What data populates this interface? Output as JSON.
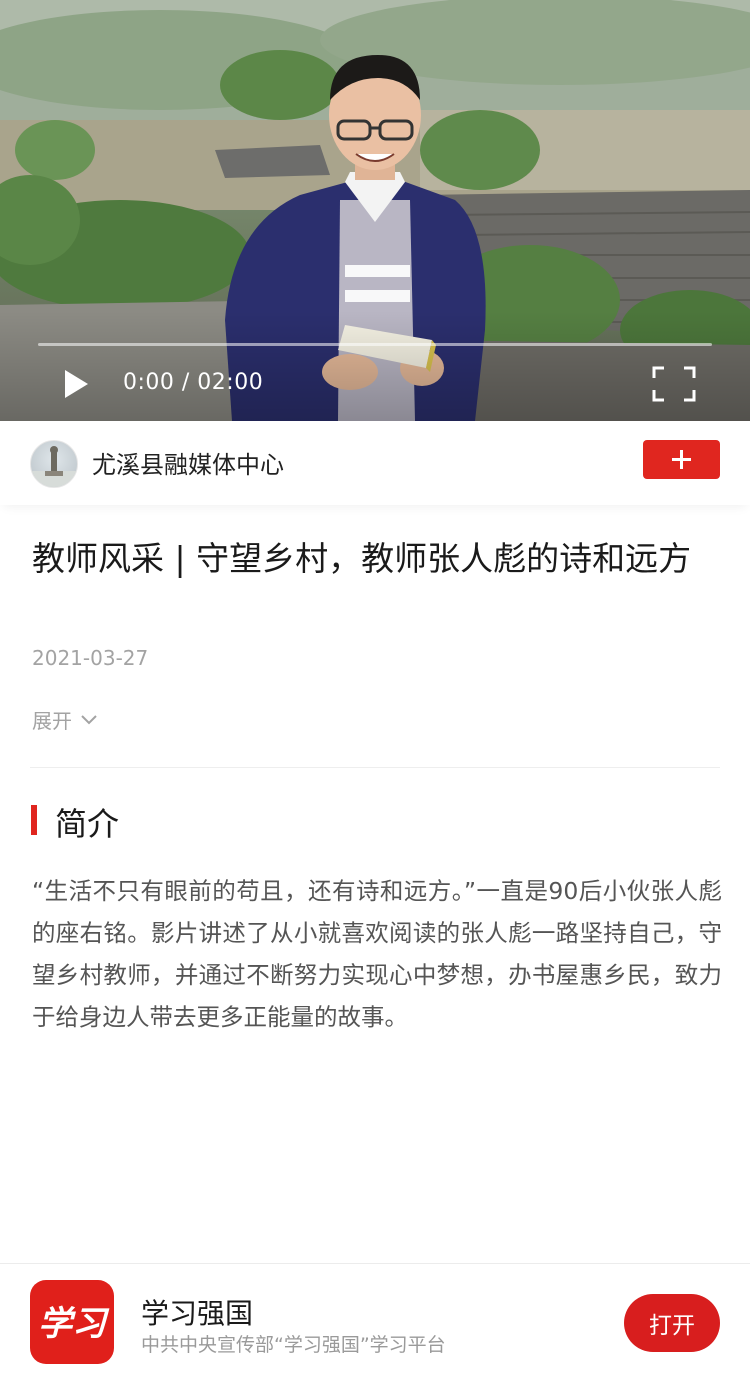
{
  "video": {
    "time_display": "0:00 / 02:00",
    "progress": 0
  },
  "author": {
    "name": "尤溪县融媒体中心"
  },
  "article": {
    "title": "教师风采 | 守望乡村，教师张人彪的诗和远方",
    "date": "2021-03-27",
    "expand_label": "展开"
  },
  "intro": {
    "heading": "简介",
    "body": "“生活不只有眼前的苟且，还有诗和远方。”一直是90后小伙张人彪的座右铭。影片讲述了从小就喜欢阅读的张人彪一路坚持自己，守望乡村教师，并通过不断努力实现心中梦想，办书屋惠乡民，致力于给身边人带去更多正能量的故事。"
  },
  "app_banner": {
    "logo_text": "学习",
    "name": "学习强国",
    "description": "中共中央宣传部“学习强国”学习平台",
    "open_label": "打开"
  },
  "icons": {
    "play": "play-icon",
    "fullscreen": "fullscreen-icon",
    "plus": "plus-icon",
    "expand": "chevron-down-icon"
  },
  "colors": {
    "accent": "#e0261f",
    "muted_text": "#a3a3a3",
    "body_text": "#555555"
  }
}
